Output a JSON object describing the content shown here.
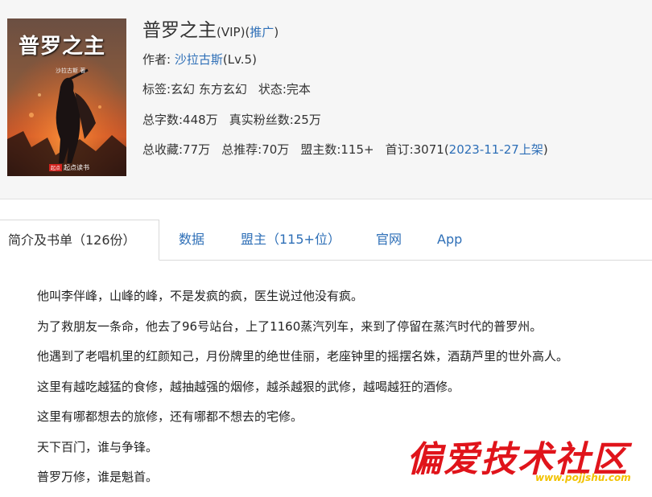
{
  "book": {
    "title": "普罗之主",
    "vip": "(VIP)",
    "promo_open": "(",
    "promo": "推广",
    "promo_close": ")",
    "author_label": "作者:",
    "author": "沙拉古斯",
    "author_level": "(Lv.5)",
    "tags_line": "标签:玄幻 东方玄幻",
    "status": "状态:完本",
    "word_count": "总字数:448万",
    "fans": "真实粉丝数:25万",
    "favorites": "总收藏:77万",
    "recommends": "总推荐:70万",
    "alliance": "盟主数:115+",
    "first_sub": "首订:3071",
    "listing_open": "(",
    "listing_date": "2023-11-27上架",
    "listing_close": ")"
  },
  "cover": {
    "title": "普罗之主",
    "author": "沙拉古斯 著",
    "badge": "起点",
    "publisher": "起点读书"
  },
  "tabs": [
    {
      "label": "简介及书单（126份）",
      "active": true
    },
    {
      "label": "数据"
    },
    {
      "label": "盟主（115+位）"
    },
    {
      "label": "官网"
    },
    {
      "label": "App"
    }
  ],
  "intro": [
    "他叫李伴峰，山峰的峰，不是发疯的疯，医生说过他没有疯。",
    "为了救朋友一条命，他去了96号站台，上了1160蒸汽列车，来到了停留在蒸汽时代的普罗州。",
    "他遇到了老唱机里的红颜知己，月份牌里的绝世佳丽，老座钟里的摇摆名姝，酒葫芦里的世外高人。",
    "这里有越吃越猛的食修，越抽越强的烟修，越杀越狠的武修，越喝越狂的酒修。",
    "这里有哪都想去的旅修，还有哪都不想去的宅修。",
    "天下百门，谁与争锋。",
    "普罗万修，谁是魁首。"
  ],
  "watermark": {
    "text": "偏爱技术社区",
    "url": "www.pojjshu.com"
  },
  "colors": {
    "link": "#2e6fb7",
    "header_bg": "#f6f6f6",
    "watermark_red": "#e0141b",
    "watermark_yellow": "#f2c200"
  }
}
